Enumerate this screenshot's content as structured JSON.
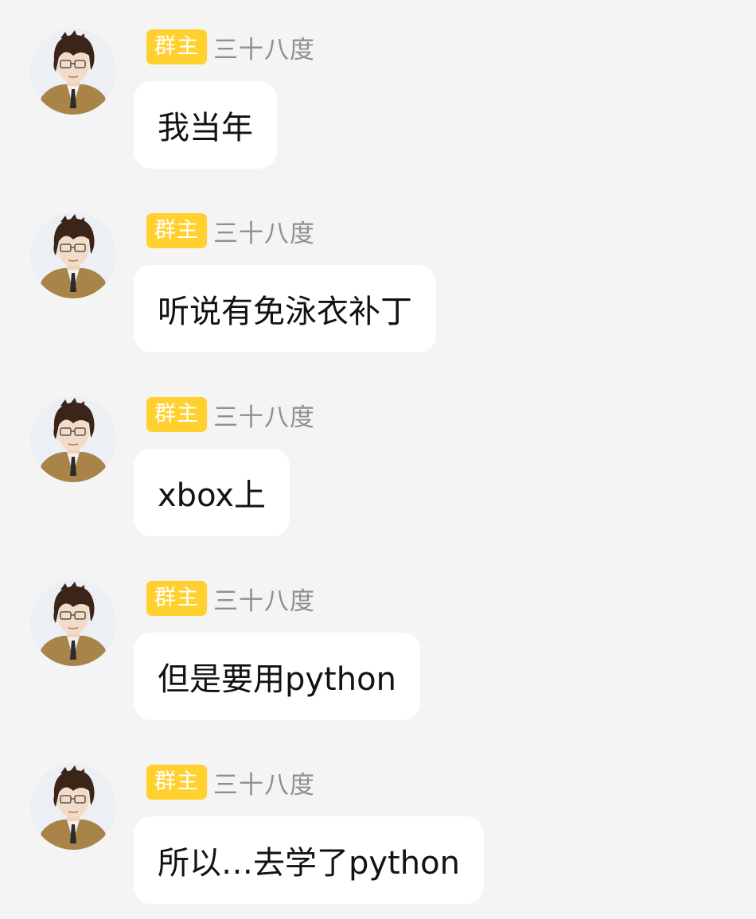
{
  "messages": [
    {
      "role_badge": "群主",
      "sender": "三十八度",
      "text": "我当年"
    },
    {
      "role_badge": "群主",
      "sender": "三十八度",
      "text": "听说有免泳衣补丁"
    },
    {
      "role_badge": "群主",
      "sender": "三十八度",
      "text": "xbox上"
    },
    {
      "role_badge": "群主",
      "sender": "三十八度",
      "text": "但是要用python"
    },
    {
      "role_badge": "群主",
      "sender": "三十八度",
      "text": "所以…去学了python"
    }
  ],
  "colors": {
    "background": "#f4f4f4",
    "bubble": "#ffffff",
    "badge": "#ffd02e",
    "sender_name": "#8f8f8f",
    "message_text": "#121212"
  },
  "icons": {
    "avatar": "anime-boy-with-glasses-avatar"
  }
}
